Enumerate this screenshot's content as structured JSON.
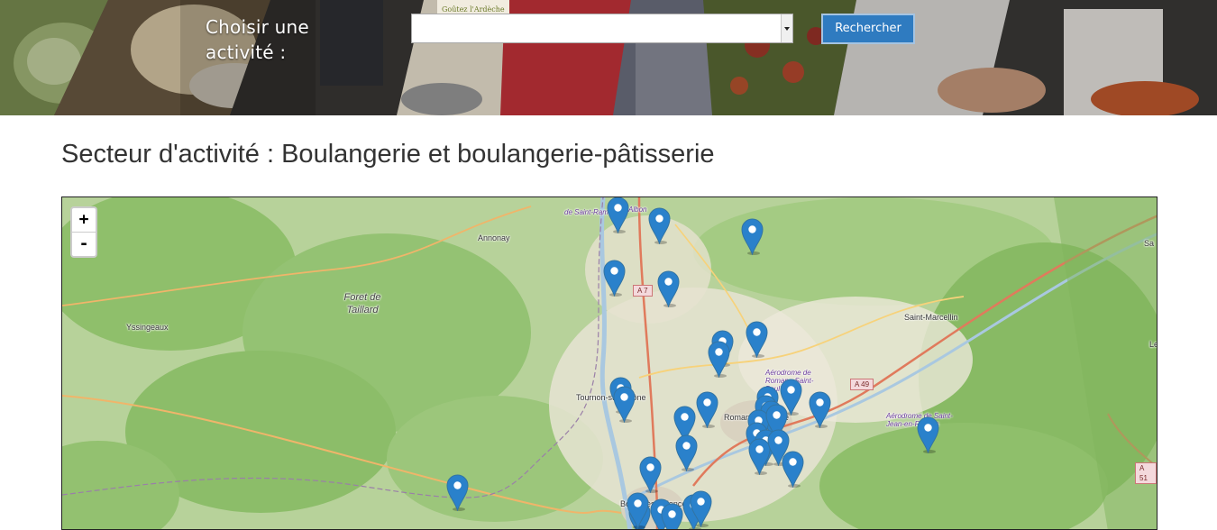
{
  "header": {
    "activity_label": "Choisir une activité :",
    "activity_select_value": "",
    "search_button": "Rechercher",
    "logo_text": "Goûtez l'Ardèche"
  },
  "page": {
    "title": "Secteur d'activité : Boulangerie et boulangerie-pâtisserie"
  },
  "map": {
    "zoom_in": "+",
    "zoom_out": "-",
    "places": {
      "annonay": "Annonay",
      "foret": "Foret de Taillard",
      "yssingeaux": "Yssingeaux",
      "saint_marcellin": "Saint-Marcellin",
      "tournon": "Tournon-sur-Rhône",
      "romans": "Romans-sur-Isère",
      "bourg": "Bourg-lès-Valence",
      "albon": "Albon",
      "aero_saint_rambert": "de Saint-Rambert",
      "aero_romans": "Aérodrome de Romans-Saint-Paul",
      "aero_royans": "Aérodrome de Saint-Jean-en-Royans",
      "edge_sa": "Sa",
      "edge_le": "Le"
    },
    "roads": {
      "a7": "A 7",
      "a49": "A 49",
      "a51": "A 51"
    },
    "marker_color": "#2a81cb"
  }
}
